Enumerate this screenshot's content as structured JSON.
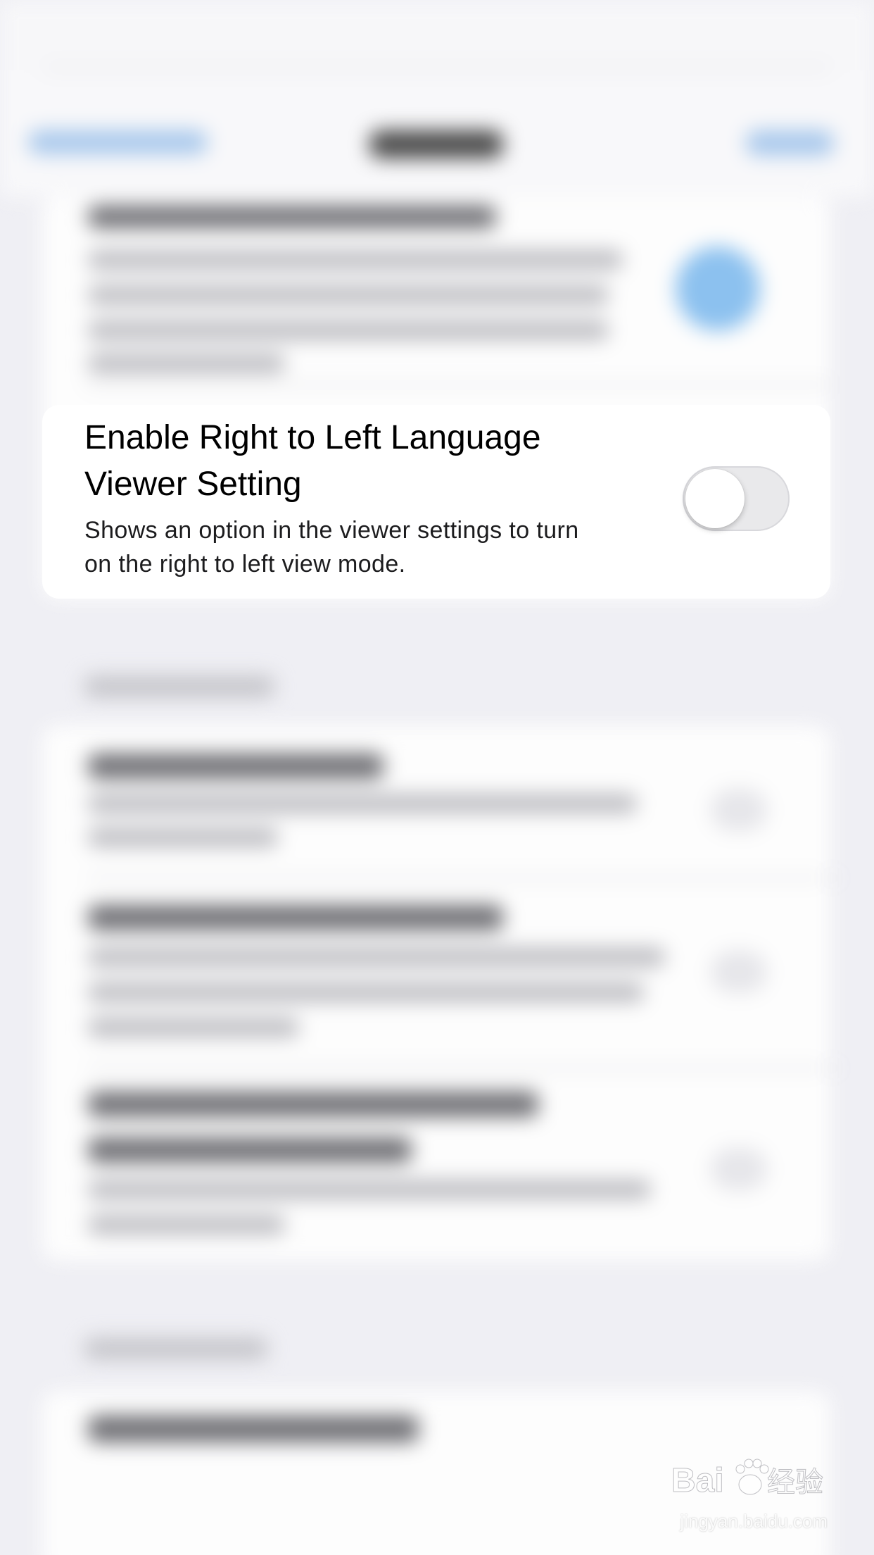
{
  "setting": {
    "title_line1": "Enable Right to Left Language",
    "title_line2": "Viewer Setting",
    "description_line1": "Shows an option in the viewer settings to turn",
    "description_line2": "on the right to left view mode.",
    "toggle_on": false
  },
  "watermark": {
    "site": "jingyan.baidu.com"
  },
  "colors": {
    "background": "#efeff4",
    "card": "#ffffff",
    "toggle_off": "#e9e9eb",
    "accent_blur": "#8cc1ef"
  }
}
